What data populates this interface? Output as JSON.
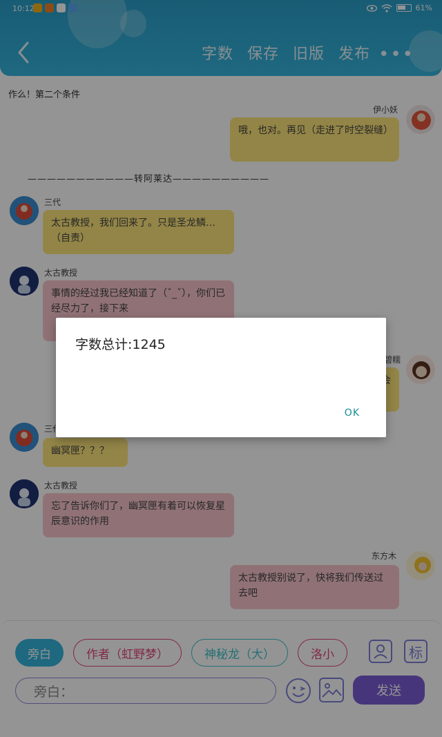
{
  "status_bar": {
    "time": "10:12",
    "battery": "61%",
    "app_icons": [
      "weibo-icon",
      "store-icon",
      "wechat-icon",
      "app-icon"
    ]
  },
  "header": {
    "actions": [
      "字数",
      "保存",
      "旧版",
      "发布"
    ],
    "more": "•••",
    "color": "#35b4dd"
  },
  "chat": {
    "top_text": "作么！第二个条件",
    "divider": "———————————转阿莱达——————————",
    "messages": [
      {
        "side": "right",
        "sender": "伊小妖",
        "text": "哦，也对。再见（走进了时空裂缝）",
        "color": "yellow"
      },
      {
        "side": "left",
        "sender": "三代",
        "text": "太古教授，我们回来了。只是圣龙鳞…（自责）",
        "color": "yellow"
      },
      {
        "side": "left",
        "sender": "太古教授",
        "text": "事情的经过我已经知道了（ˇ_ˇ），你们已经尽力了，接下来",
        "color": "pink"
      },
      {
        "side": "right",
        "sender": "碧糯",
        "text": "会",
        "color": "yellow"
      },
      {
        "side": "left",
        "sender": "三代",
        "text": "幽冥匣？？？",
        "color": "yellow"
      },
      {
        "side": "left",
        "sender": "太古教授",
        "text": "忘了告诉你们了，幽冥匣有着可以恢复星辰意识的作用",
        "color": "pink"
      },
      {
        "side": "right",
        "sender": "东方木",
        "text": "太古教授别说了，快将我们传送过去吧",
        "color": "pink"
      }
    ]
  },
  "bottom": {
    "roles": [
      "旁白",
      "作者（虹野梦）",
      "神秘龙（大）",
      "洛小"
    ],
    "input_placeholder": "旁白：",
    "send_label": "发送",
    "icons": [
      "user-icon",
      "tag-icon",
      "emoji-icon",
      "image-icon"
    ],
    "tag_label": "标"
  },
  "dialog": {
    "message": "字数总计:1245",
    "ok_label": "OK"
  }
}
